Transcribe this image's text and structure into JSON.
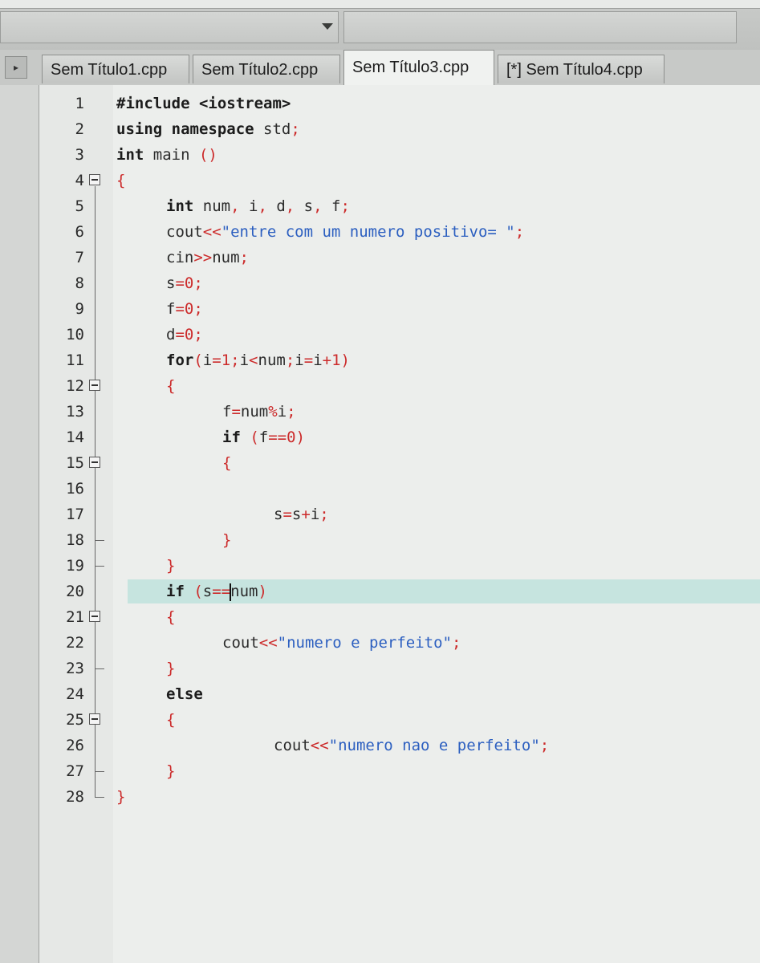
{
  "tabs": [
    {
      "label": "Sem Título1.cpp",
      "active": false
    },
    {
      "label": "Sem Título2.cpp",
      "active": false
    },
    {
      "label": "Sem Título3.cpp",
      "active": true
    },
    {
      "label": "[*] Sem Título4.cpp",
      "active": false
    }
  ],
  "tab_scroll_icon": "triangle-right",
  "editor": {
    "current_line": 20,
    "lines": [
      {
        "n": "1",
        "fold": "",
        "indent": 0,
        "tokens": [
          [
            "pp",
            "#include <iostream>"
          ]
        ]
      },
      {
        "n": "2",
        "fold": "",
        "indent": 0,
        "tokens": [
          [
            "kw",
            "using namespace "
          ],
          [
            "plain",
            "std"
          ],
          [
            "sym",
            ";"
          ]
        ]
      },
      {
        "n": "3",
        "fold": "",
        "indent": 0,
        "tokens": [
          [
            "kw",
            "int "
          ],
          [
            "plain",
            "main "
          ],
          [
            "sym",
            "()"
          ]
        ]
      },
      {
        "n": "4",
        "fold": "open",
        "indent": 0,
        "tokens": [
          [
            "sym",
            "{"
          ]
        ]
      },
      {
        "n": "5",
        "fold": "",
        "indent": 1,
        "tokens": [
          [
            "kw",
            "int "
          ],
          [
            "plain",
            "num"
          ],
          [
            "sym",
            ", "
          ],
          [
            "plain",
            "i"
          ],
          [
            "sym",
            ", "
          ],
          [
            "plain",
            "d"
          ],
          [
            "sym",
            ", "
          ],
          [
            "plain",
            "s"
          ],
          [
            "sym",
            ", "
          ],
          [
            "plain",
            "f"
          ],
          [
            "sym",
            ";"
          ]
        ]
      },
      {
        "n": "6",
        "fold": "",
        "indent": 1,
        "tokens": [
          [
            "plain",
            "cout"
          ],
          [
            "sym",
            "<<"
          ],
          [
            "str",
            "\"entre com um numero positivo= \""
          ],
          [
            "sym",
            ";"
          ]
        ]
      },
      {
        "n": "7",
        "fold": "",
        "indent": 1,
        "tokens": [
          [
            "plain",
            "cin"
          ],
          [
            "sym",
            ">>"
          ],
          [
            "plain",
            "num"
          ],
          [
            "sym",
            ";"
          ]
        ]
      },
      {
        "n": "8",
        "fold": "",
        "indent": 1,
        "tokens": [
          [
            "plain",
            "s"
          ],
          [
            "sym",
            "="
          ],
          [
            "num",
            "0"
          ],
          [
            "sym",
            ";"
          ]
        ]
      },
      {
        "n": "9",
        "fold": "",
        "indent": 1,
        "tokens": [
          [
            "plain",
            "f"
          ],
          [
            "sym",
            "="
          ],
          [
            "num",
            "0"
          ],
          [
            "sym",
            ";"
          ]
        ]
      },
      {
        "n": "10",
        "fold": "",
        "indent": 1,
        "tokens": [
          [
            "plain",
            "d"
          ],
          [
            "sym",
            "="
          ],
          [
            "num",
            "0"
          ],
          [
            "sym",
            ";"
          ]
        ]
      },
      {
        "n": "11",
        "fold": "",
        "indent": 1,
        "tokens": [
          [
            "kw",
            "for"
          ],
          [
            "sym",
            "("
          ],
          [
            "plain",
            "i"
          ],
          [
            "sym",
            "="
          ],
          [
            "num",
            "1"
          ],
          [
            "sym",
            ";"
          ],
          [
            "plain",
            "i"
          ],
          [
            "sym",
            "<"
          ],
          [
            "plain",
            "num"
          ],
          [
            "sym",
            ";"
          ],
          [
            "plain",
            "i"
          ],
          [
            "sym",
            "="
          ],
          [
            "plain",
            "i"
          ],
          [
            "sym",
            "+"
          ],
          [
            "num",
            "1"
          ],
          [
            "sym",
            ")"
          ]
        ]
      },
      {
        "n": "12",
        "fold": "open",
        "indent": 1,
        "tokens": [
          [
            "sym",
            "{"
          ]
        ]
      },
      {
        "n": "13",
        "fold": "",
        "indent": 2,
        "tokens": [
          [
            "plain",
            "f"
          ],
          [
            "sym",
            "="
          ],
          [
            "plain",
            "num"
          ],
          [
            "sym",
            "%"
          ],
          [
            "plain",
            "i"
          ],
          [
            "sym",
            ";"
          ]
        ]
      },
      {
        "n": "14",
        "fold": "",
        "indent": 2,
        "tokens": [
          [
            "kw",
            "if "
          ],
          [
            "sym",
            "("
          ],
          [
            "plain",
            "f"
          ],
          [
            "sym",
            "=="
          ],
          [
            "num",
            "0"
          ],
          [
            "sym",
            ")"
          ]
        ]
      },
      {
        "n": "15",
        "fold": "open",
        "indent": 2,
        "tokens": [
          [
            "sym",
            "{"
          ]
        ]
      },
      {
        "n": "16",
        "fold": "",
        "indent": 2,
        "tokens": []
      },
      {
        "n": "17",
        "fold": "",
        "indent": 3,
        "tokens": [
          [
            "plain",
            "s"
          ],
          [
            "sym",
            "="
          ],
          [
            "plain",
            "s"
          ],
          [
            "sym",
            "+"
          ],
          [
            "plain",
            "i"
          ],
          [
            "sym",
            ";"
          ]
        ]
      },
      {
        "n": "18",
        "fold": "end",
        "indent": 2,
        "tokens": [
          [
            "sym",
            "}"
          ]
        ]
      },
      {
        "n": "19",
        "fold": "end",
        "indent": 1,
        "tokens": [
          [
            "sym",
            "}"
          ]
        ]
      },
      {
        "n": "20",
        "fold": "",
        "indent": 1,
        "tokens": [
          [
            "kw",
            "if "
          ],
          [
            "sym",
            "("
          ],
          [
            "plain",
            "s"
          ],
          [
            "sym",
            "=="
          ],
          [
            "plain",
            "num"
          ],
          [
            "sym",
            ")"
          ]
        ]
      },
      {
        "n": "21",
        "fold": "open",
        "indent": 1,
        "tokens": [
          [
            "sym",
            "{"
          ]
        ]
      },
      {
        "n": "22",
        "fold": "",
        "indent": 2,
        "tokens": [
          [
            "plain",
            "cout"
          ],
          [
            "sym",
            "<<"
          ],
          [
            "str",
            "\"numero e perfeito\""
          ],
          [
            "sym",
            ";"
          ]
        ]
      },
      {
        "n": "23",
        "fold": "end",
        "indent": 1,
        "tokens": [
          [
            "sym",
            "}"
          ]
        ]
      },
      {
        "n": "24",
        "fold": "",
        "indent": 1,
        "tokens": [
          [
            "kw",
            "else"
          ]
        ]
      },
      {
        "n": "25",
        "fold": "open",
        "indent": 1,
        "tokens": [
          [
            "sym",
            "{"
          ]
        ]
      },
      {
        "n": "26",
        "fold": "",
        "indent": 3,
        "tokens": [
          [
            "plain",
            "cout"
          ],
          [
            "sym",
            "<<"
          ],
          [
            "str",
            "\"numero nao e perfeito\""
          ],
          [
            "sym",
            ";"
          ]
        ]
      },
      {
        "n": "27",
        "fold": "end",
        "indent": 1,
        "tokens": [
          [
            "sym",
            "}"
          ]
        ]
      },
      {
        "n": "28",
        "fold": "end",
        "indent": 0,
        "tokens": [
          [
            "sym",
            "}"
          ]
        ]
      }
    ]
  },
  "colors": {
    "keyword": "#1c1c1c",
    "symbol": "#cc2b2b",
    "string": "#2c5fc0",
    "current_line_bg": "#c6e4df"
  }
}
